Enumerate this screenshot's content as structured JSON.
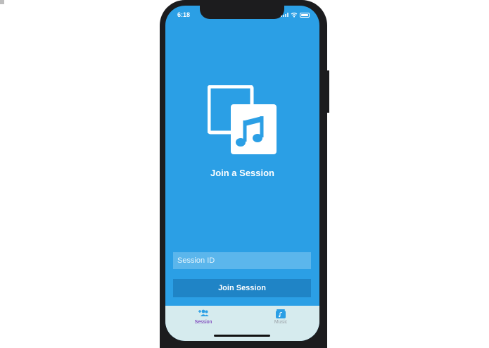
{
  "status_bar": {
    "time": "6:18"
  },
  "main": {
    "logo_icon": "music-session-icon",
    "title": "Join a Session"
  },
  "form": {
    "session_id_placeholder": "Session ID",
    "session_id_value": "",
    "join_button_label": "Join Session"
  },
  "tab_bar": {
    "items": [
      {
        "label": "Session",
        "icon": "add-users-icon",
        "selected": true
      },
      {
        "label": "Music",
        "icon": "music-library-icon",
        "selected": false
      }
    ]
  },
  "colors": {
    "background": "#2b9fe5",
    "input": "#5bb6ec",
    "button": "#1f84c6",
    "tab_bar": "#d6ebee",
    "tab_selected": "#6a1fb0",
    "tab_unselected": "#9aa0a6"
  }
}
